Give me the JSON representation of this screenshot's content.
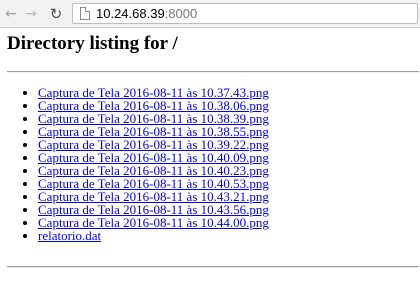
{
  "browser": {
    "url_host": "10.24.68.39",
    "url_port": ":8000",
    "back_glyph": "←",
    "forward_glyph": "→",
    "reload_glyph": "↻"
  },
  "page": {
    "title": "Directory listing for /",
    "files": [
      "Captura de Tela 2016-08-11 às 10.37.43.png",
      "Captura de Tela 2016-08-11 às 10.38.06.png",
      "Captura de Tela 2016-08-11 às 10.38.39.png",
      "Captura de Tela 2016-08-11 às 10.38.55.png",
      "Captura de Tela 2016-08-11 às 10.39.22.png",
      "Captura de Tela 2016-08-11 às 10.40.09.png",
      "Captura de Tela 2016-08-11 às 10.40.23.png",
      "Captura de Tela 2016-08-11 às 10.40.53.png",
      "Captura de Tela 2016-08-11 às 10.43.21.png",
      "Captura de Tela 2016-08-11 às 10.43.56.png",
      "Captura de Tela 2016-08-11 às 10.44.00.png",
      "relatorio.dat"
    ]
  }
}
